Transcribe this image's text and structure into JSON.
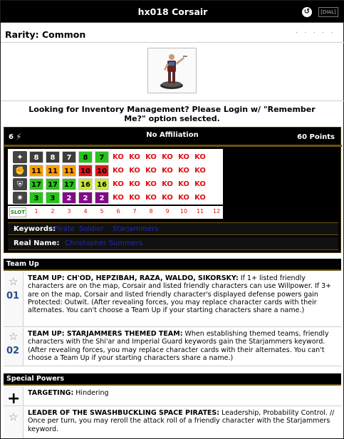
{
  "header": {
    "title": "hx018 Corsair",
    "undo_icon": "undo-icon",
    "dial_button": "[DIAL]"
  },
  "rarity": "Rarity: Common",
  "rating_dots": "· · · · ·",
  "login_message": "Looking for Inventory Management? Please Login w/ \"Remember Me?\" option selected.",
  "dial": {
    "dimension": "6",
    "affiliation": "No Affiliation",
    "points": "60 Points",
    "speed_icon": "boot-icon",
    "attack_icon": "fist-icon",
    "defense_icon": "shield-icon",
    "damage_icon": "starburst-icon",
    "slot_label": "SLOT",
    "rows": [
      {
        "stat": "speed",
        "values": [
          "8",
          "8",
          "7",
          "8",
          "7",
          "KO",
          "KO",
          "KO",
          "KO",
          "KO",
          "KO"
        ]
      },
      {
        "stat": "attack",
        "values": [
          "11",
          "11",
          "11",
          "10",
          "10",
          "KO",
          "KO",
          "KO",
          "KO",
          "KO",
          "KO"
        ]
      },
      {
        "stat": "defense",
        "values": [
          "17",
          "17",
          "17",
          "16",
          "16",
          "KO",
          "KO",
          "KO",
          "KO",
          "KO",
          "KO"
        ]
      },
      {
        "stat": "damage",
        "values": [
          "3",
          "3",
          "2",
          "2",
          "2",
          "KO",
          "KO",
          "KO",
          "KO",
          "KO",
          "KO"
        ]
      }
    ],
    "slot_numbers": [
      "1",
      "2",
      "3",
      "4",
      "5",
      "6",
      "7",
      "8",
      "9",
      "10",
      "11",
      "12"
    ],
    "keywords_label": "Keywords:",
    "keywords": [
      "Pirate",
      "Soldier",
      "Starjammers"
    ],
    "real_name_label": "Real Name:",
    "real_name": "Christopher Summers"
  },
  "team_up": {
    "heading": "Team Up",
    "items": [
      {
        "number": "01",
        "title": "TEAM UP: CH'OD, HEPZIBAH, RAZA, WALDO, SIKORSKY:",
        "text": " If 1+ listed friendly characters are on the map, Corsair and listed friendly characters can use Willpower. If 3+ are on the map, Corsair and listed friendly character's displayed defense powers gain Protected: Outwit. (After revealing forces, you may replace character cards with their alternates. You can't choose a Team Up if your starting characters share a name.)"
      },
      {
        "number": "02",
        "title": "TEAM UP: STARJAMMERS THEMED TEAM:",
        "text": " When establishing themed teams, friendly characters with the Shi'ar and Imperial Guard keywords gain the Starjammers keyword. (After revealing forces, you may replace character cards with their alternates. You can't choose a Team Up if your starting characters share a name.)"
      }
    ]
  },
  "special_powers": {
    "heading": "Special Powers",
    "items": [
      {
        "icon": "plus-icon",
        "title": "TARGETING:",
        "text": " Hindering"
      },
      {
        "icon": "star-icon",
        "title": "LEADER OF THE SWASHBUCKLING SPACE PIRATES:",
        "text": " Leadership, Probability Control. // Once per turn, you may reroll the attack roll of a friendly character with the Starjammers keyword."
      }
    ]
  },
  "colors": {
    "grey": "#3d3d3d",
    "green": "#29c21a",
    "orange": "#ff9b00",
    "red": "#e0161a",
    "lime": "#c8e838",
    "purple": "#800a87",
    "ko": "#e01010"
  }
}
